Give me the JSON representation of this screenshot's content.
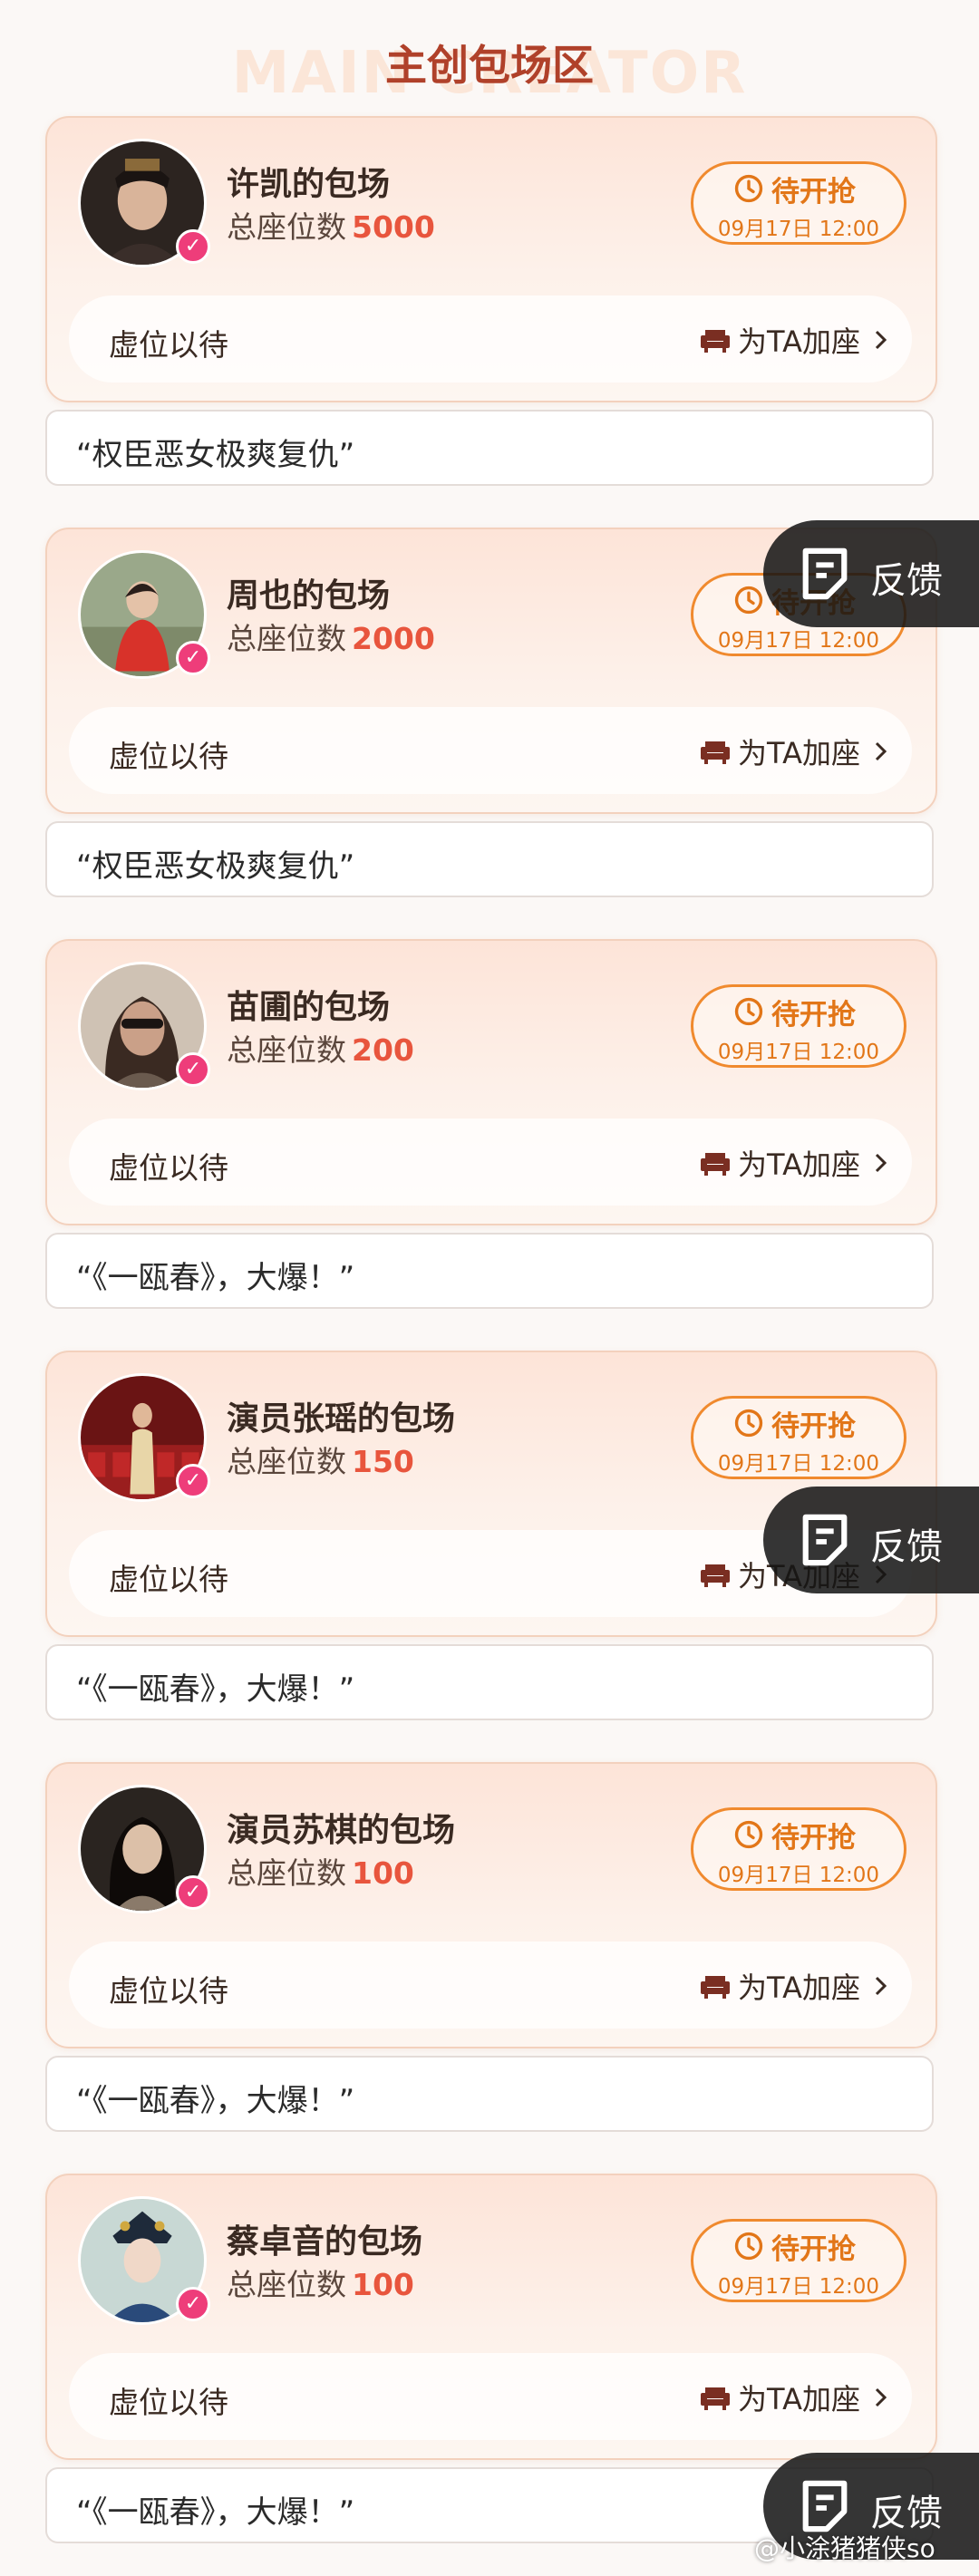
{
  "header": {
    "title": "主创包场区",
    "watermark": "MAIN CREATOR"
  },
  "common": {
    "status_label": "待开抢",
    "status_time": "09月17日 12:00",
    "reserve_label": "虚位以待",
    "add_seat_label": "为TA加座",
    "seat_label": "总座位数",
    "feedback_label": "反馈"
  },
  "creators": [
    {
      "name": "许凯的包场",
      "seats": "5000",
      "slogan": "“权臣恶女极爽复仇”"
    },
    {
      "name": "周也的包场",
      "seats": "2000",
      "slogan": "“权臣恶女极爽复仇”"
    },
    {
      "name": "苗圃的包场",
      "seats": "200",
      "slogan": "“《一瓯春》，大爆！”"
    },
    {
      "name": "演员张瑶的包场",
      "seats": "150",
      "slogan": "“《一瓯春》，大爆！”"
    },
    {
      "name": "演员苏棋的包场",
      "seats": "100",
      "slogan": "“《一瓯春》，大爆！”"
    },
    {
      "name": "蔡卓音的包场",
      "seats": "100",
      "slogan": "“《一瓯春》，大爆！”"
    }
  ],
  "credit": "@小涂猪猪侠so",
  "colors": {
    "accent": "#e8553d",
    "status": "#e27618",
    "verified": "#ee3d7a",
    "title": "#b0412a"
  }
}
